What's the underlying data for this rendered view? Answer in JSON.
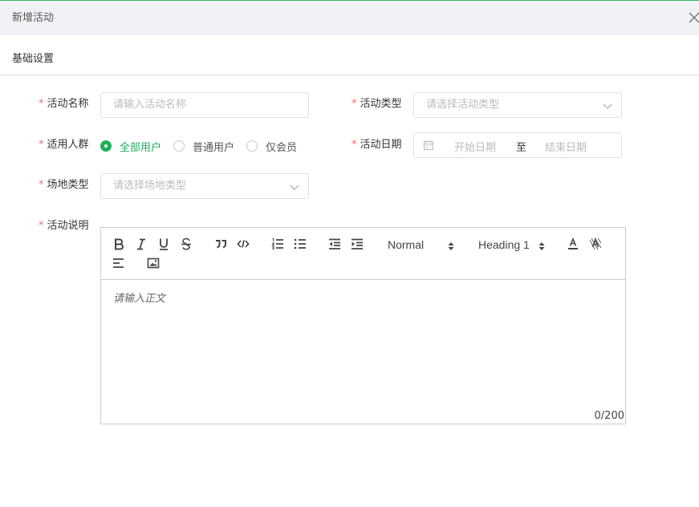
{
  "dialog": {
    "title": "新增活动",
    "close_icon": "close-icon"
  },
  "section": {
    "title": "基础设置"
  },
  "colors": {
    "accent": "#1fae5c",
    "required": "#f56c6c",
    "header_bg": "#f0f2f5"
  },
  "form": {
    "required_mark": "*",
    "activity_name": {
      "label": "活动名称",
      "placeholder": "请输入活动名称"
    },
    "activity_type": {
      "label": "活动类型",
      "placeholder": "请选择活动类型"
    },
    "audience": {
      "label": "适用人群",
      "options": [
        "全部用户",
        "普通用户",
        "仅会员"
      ],
      "selected": "全部用户"
    },
    "activity_date": {
      "label": "活动日期",
      "start_placeholder": "开始日期",
      "separator": "至",
      "end_placeholder": "结束日期"
    },
    "venue_type": {
      "label": "场地类型",
      "placeholder": "请选择场地类型"
    },
    "description": {
      "label": "活动说明"
    }
  },
  "editor": {
    "toolbar": {
      "bold": "bold-icon",
      "italic": "italic-icon",
      "underline": "underline-icon",
      "strike": "strikethrough-icon",
      "blockquote": "quote-icon",
      "code": "code-icon",
      "ordered_list": "ordered-list-icon",
      "bullet_list": "bullet-list-icon",
      "outdent": "outdent-icon",
      "indent": "indent-icon",
      "size_value": "Normal",
      "header_value": "Heading 1",
      "color": "text-color-icon",
      "clean": "clear-format-icon",
      "align": "align-left-icon",
      "image": "image-icon"
    },
    "placeholder": "请输入正文",
    "counter": "0/200"
  }
}
